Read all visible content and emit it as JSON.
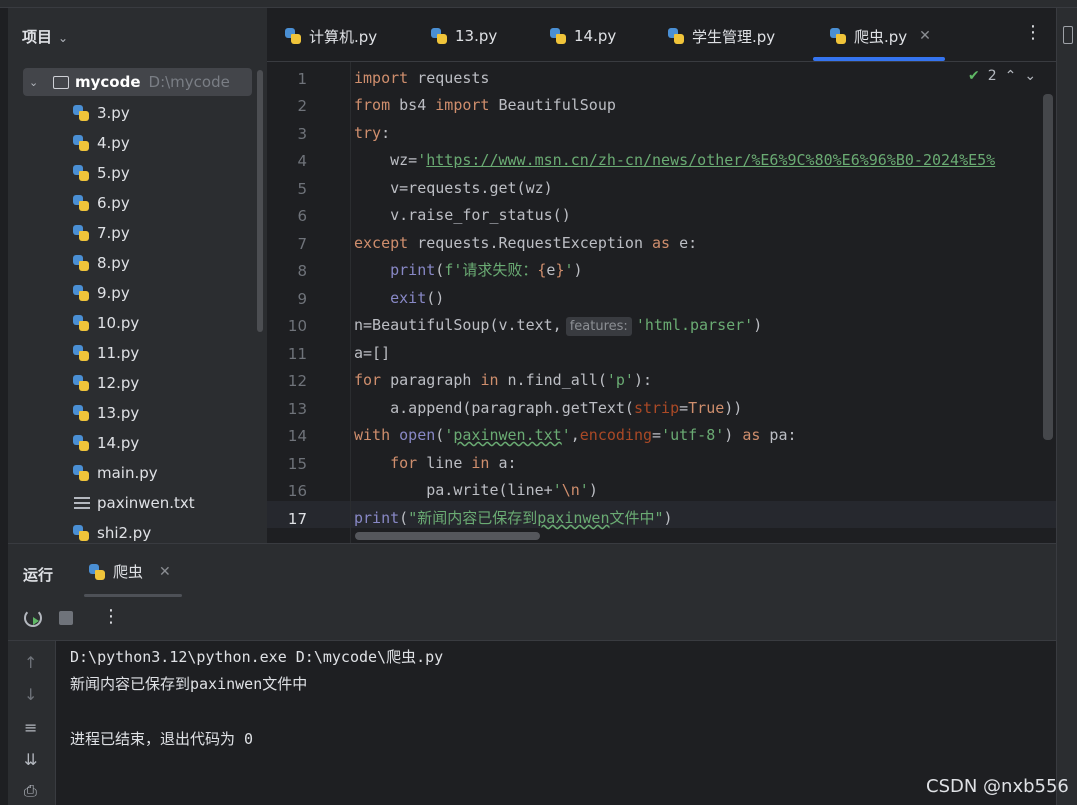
{
  "project": {
    "header": "项目",
    "root_name": "mycode",
    "root_path": "D:\\mycode",
    "files": [
      "3.py",
      "4.py",
      "5.py",
      "6.py",
      "7.py",
      "8.py",
      "9.py",
      "10.py",
      "11.py",
      "12.py",
      "13.py",
      "14.py",
      "main.py",
      "paxinwen.txt",
      "shi2.py"
    ]
  },
  "editor": {
    "tabs": [
      "计算机.py",
      "13.py",
      "14.py",
      "学生管理.py",
      "爬虫.py"
    ],
    "active_tab": "爬虫.py",
    "inspection_count": "2",
    "line_numbers": [
      "1",
      "2",
      "3",
      "4",
      "5",
      "6",
      "7",
      "8",
      "9",
      "10",
      "11",
      "12",
      "13",
      "14",
      "15",
      "16",
      "17"
    ],
    "hint": "features:",
    "code_lines": [
      "import requests",
      "from bs4 import BeautifulSoup",
      "try:",
      "    wz='https://www.msn.cn/zh-cn/news/other/%E6%9C%80%E6%96%B0-2024%E5%",
      "    v=requests.get(wz)",
      "    v.raise_for_status()",
      "except requests.RequestException as e:",
      "    print(f'请求失败：{e}')",
      "    exit()",
      "n=BeautifulSoup(v.text, 'html.parser')",
      "a=[]",
      "for paragraph in n.find_all('p'):",
      "    a.append(paragraph.getText(strip=True))",
      "with open('paxinwen.txt',encoding='utf-8') as pa:",
      "    for line in a:",
      "        pa.write(line+'\\n')",
      "print(\"新闻内容已保存到paxinwen文件中\")"
    ]
  },
  "run": {
    "title": "运行",
    "tab": "爬虫",
    "output": [
      "D:\\python3.12\\python.exe D:\\mycode\\爬虫.py",
      "新闻内容已保存到paxinwen文件中",
      "",
      "进程已结束，退出代码为 0"
    ]
  },
  "watermark": "CSDN @nxb556"
}
